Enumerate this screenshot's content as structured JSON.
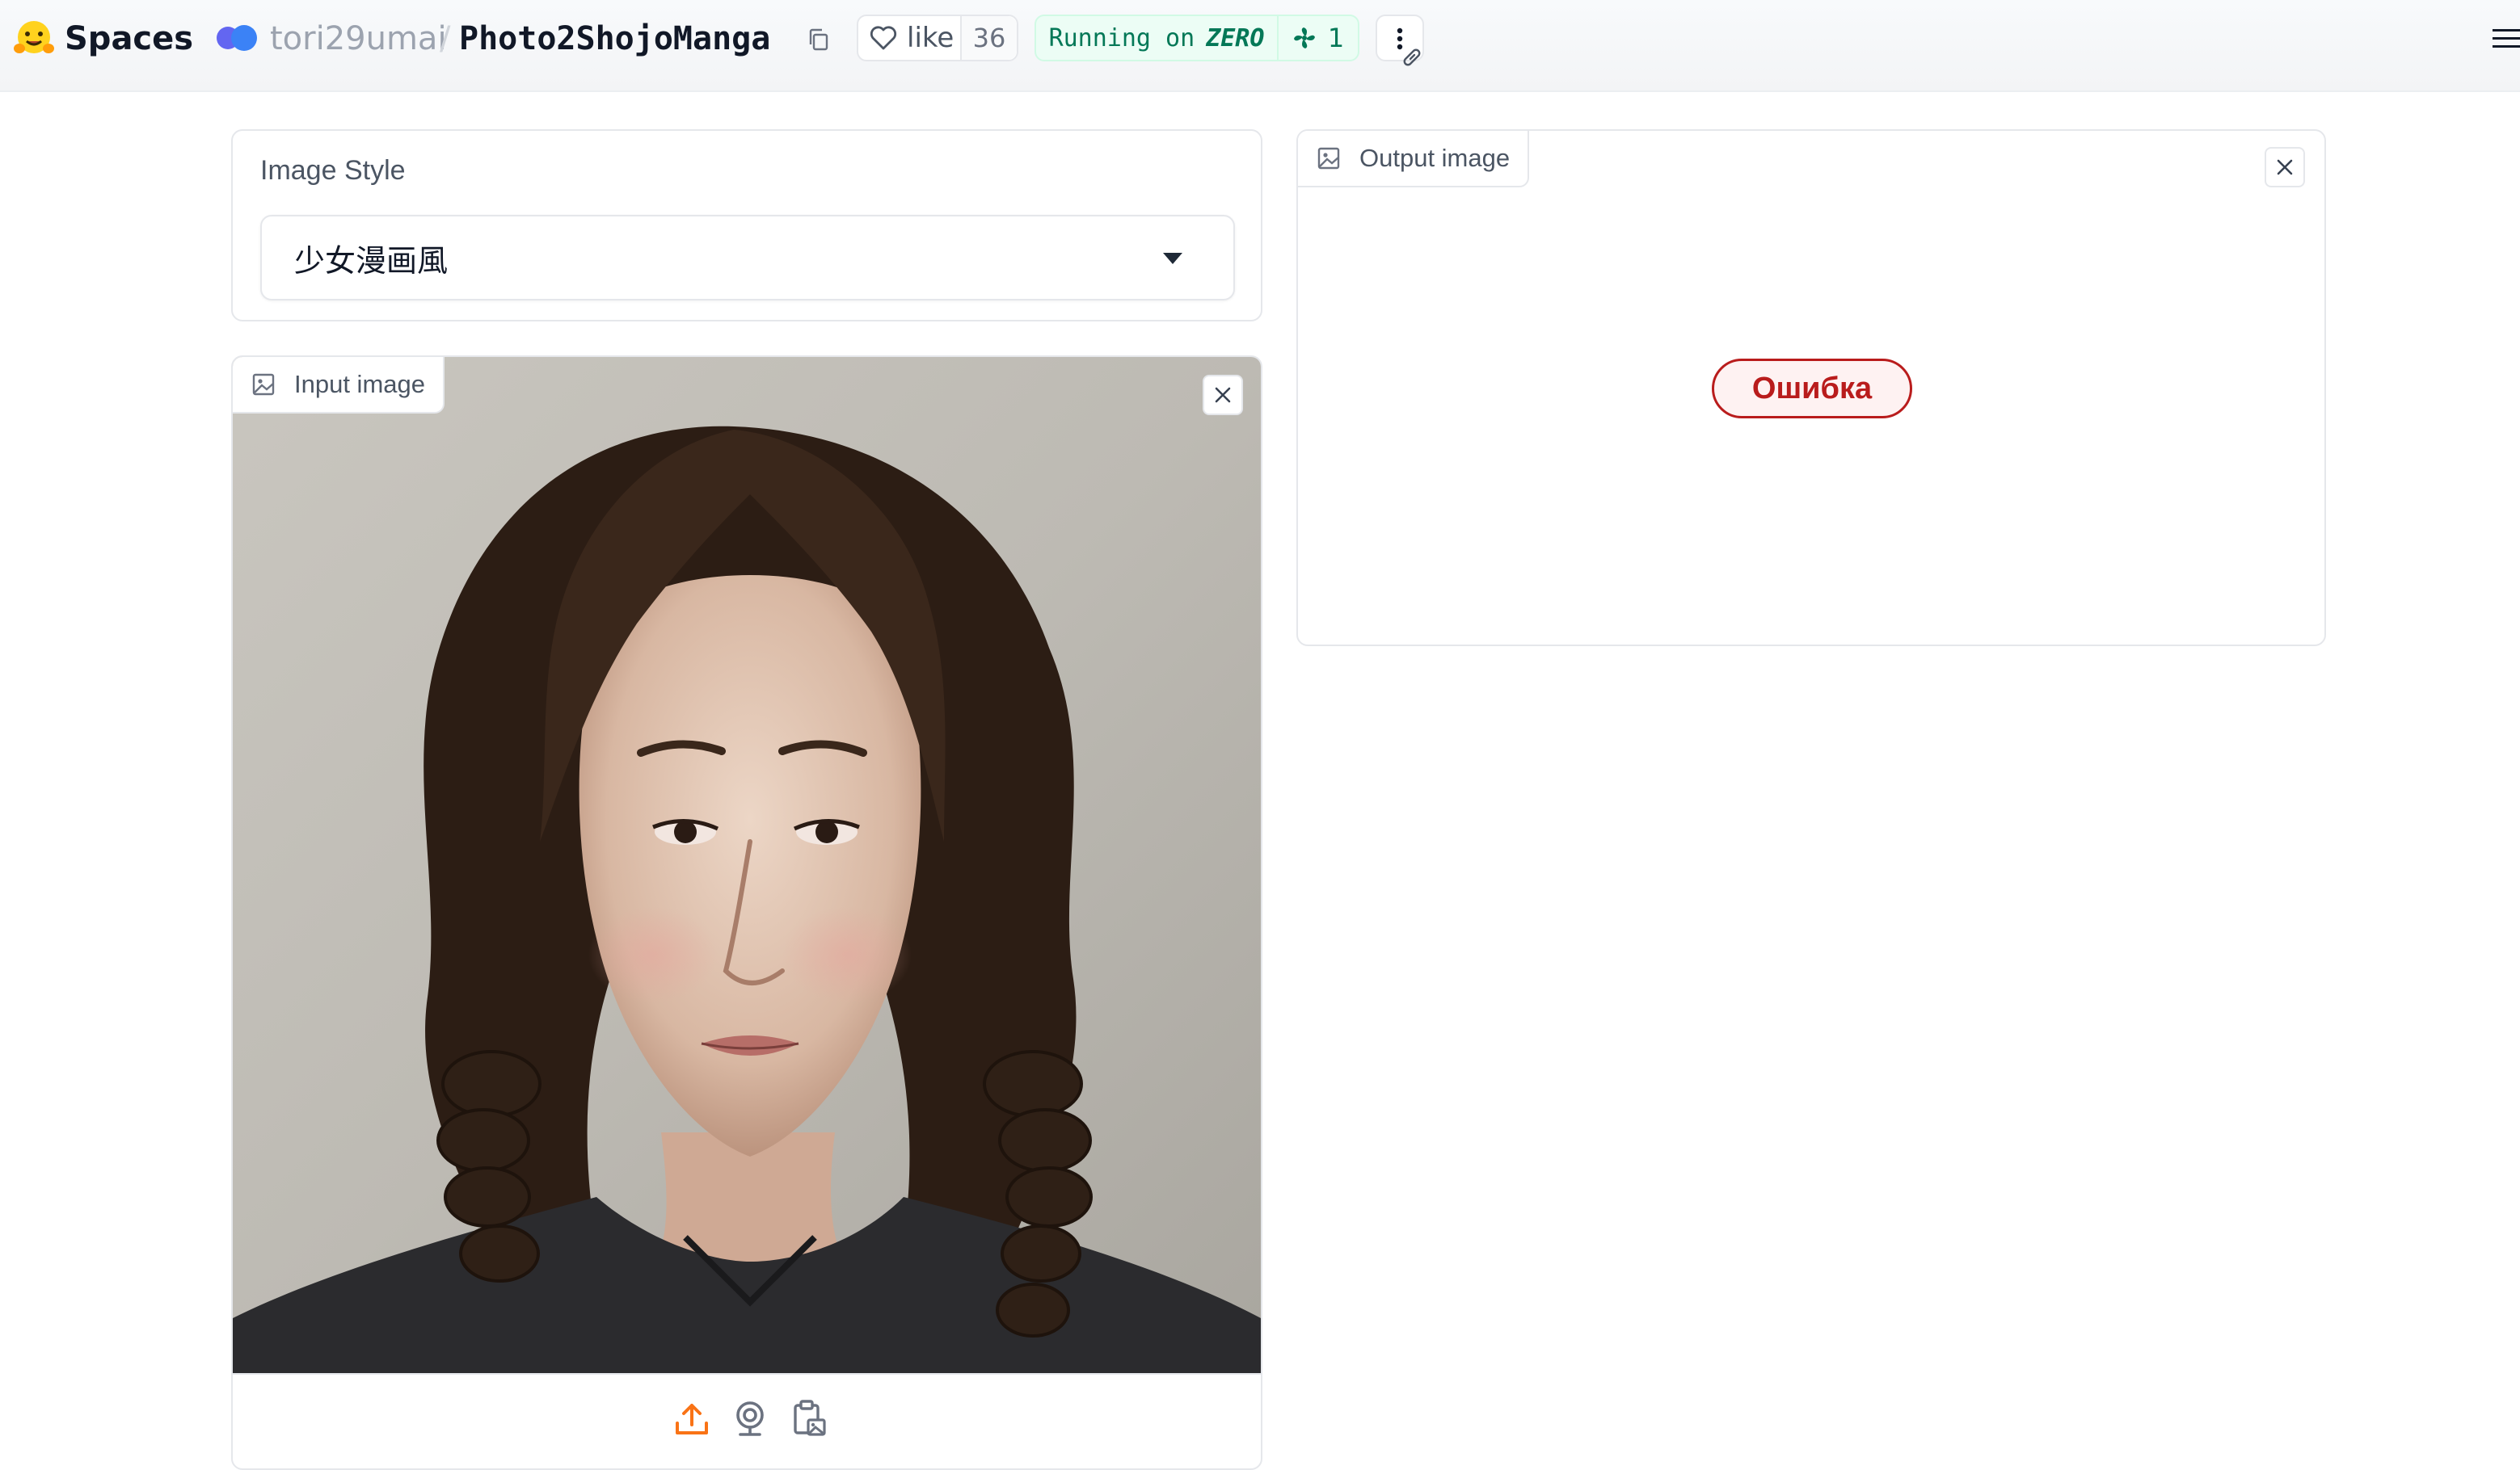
{
  "header": {
    "brand": "Spaces",
    "owner": "tori29umai",
    "separator": "/",
    "repo": "Photo2ShojoManga",
    "like_label": "like",
    "like_count": "36",
    "running_prefix": "Running on",
    "running_hardware": "ZERO",
    "running_count": "1"
  },
  "style_selector": {
    "label": "Image Style",
    "value": "少女漫画風"
  },
  "input_image": {
    "label": "Input image"
  },
  "output_image": {
    "label": "Output image",
    "error_text": "Ошибка"
  },
  "colors": {
    "accent": "#f97316",
    "error": "#b91c1c",
    "running": "#047857"
  },
  "icons": [
    "hugging-face-icon",
    "copy-icon",
    "heart-icon",
    "fan-icon",
    "more-icon",
    "link-icon",
    "menu-icon",
    "image-icon",
    "close-icon",
    "upload-icon",
    "webcam-icon",
    "clipboard-icon",
    "caret-down-icon"
  ]
}
